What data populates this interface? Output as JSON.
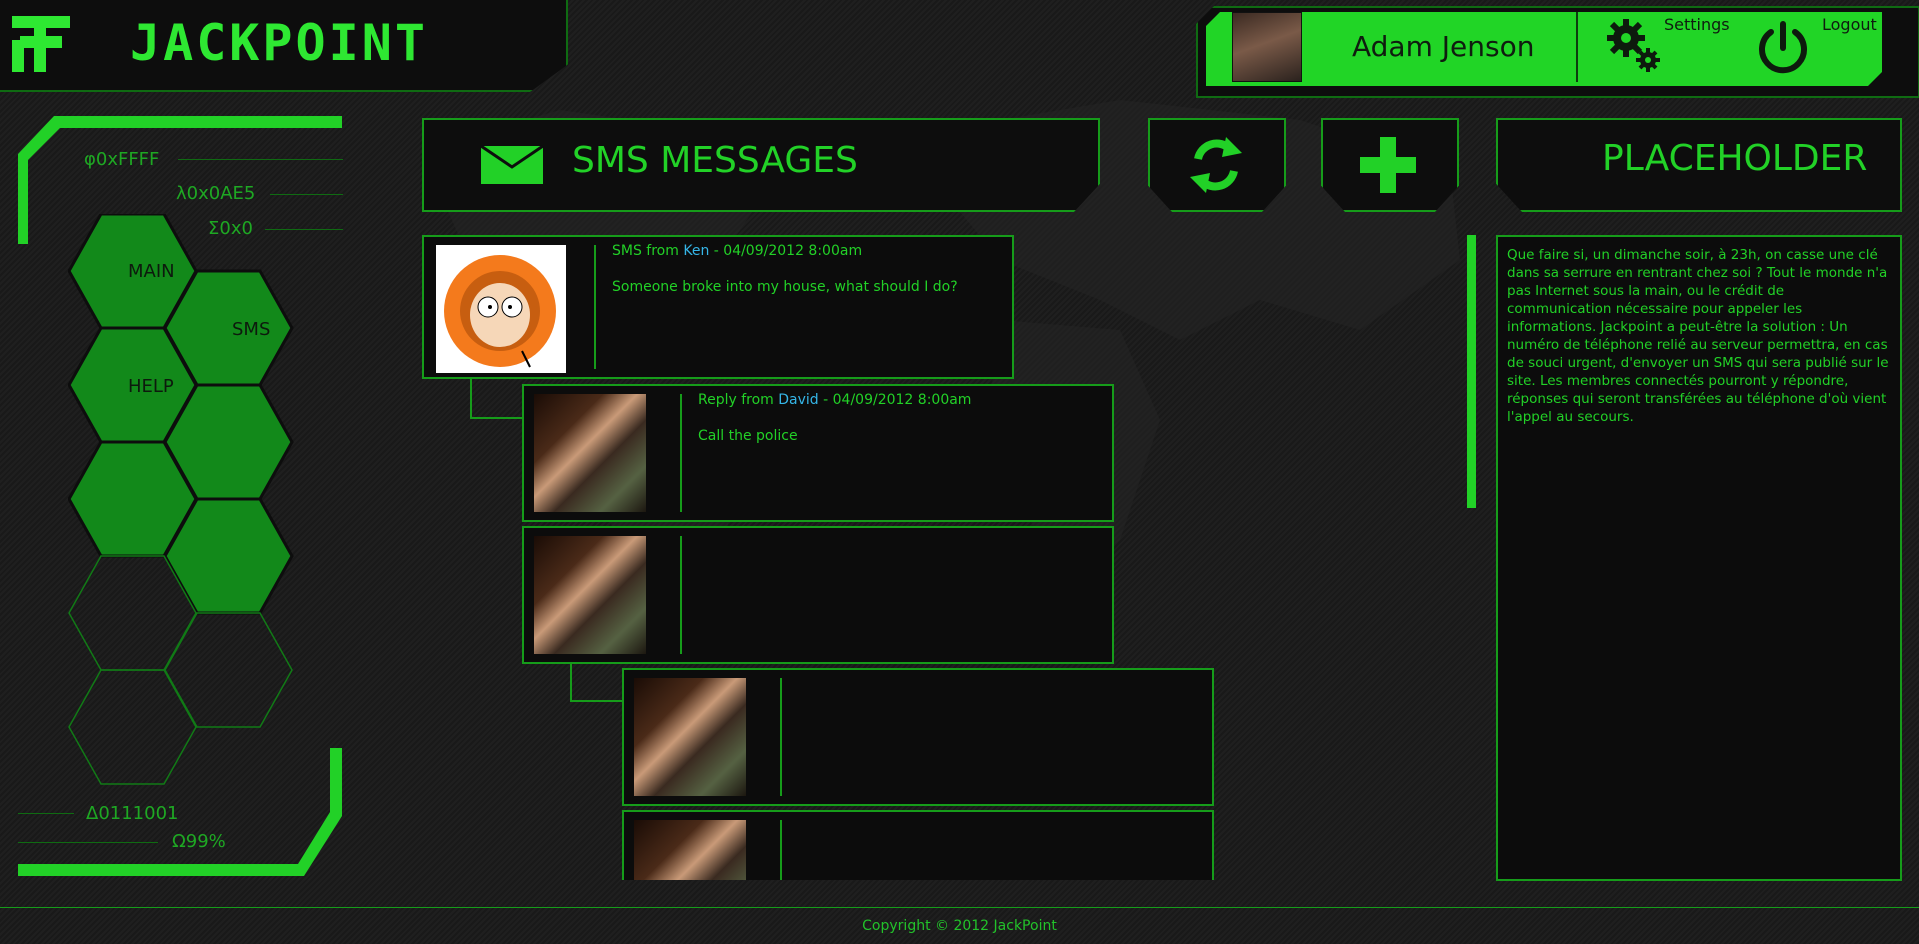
{
  "app": {
    "logo_text": "JACKPOINT"
  },
  "user": {
    "name": "Adam Jenson",
    "settings_label": "Settings",
    "logout_label": "Logout"
  },
  "codes": {
    "top": [
      "φ0xFFFF",
      "λ0x0AE5",
      "Σ0x0"
    ],
    "bottom": [
      "Δ0111001",
      "Ω99%"
    ]
  },
  "nav": {
    "main": "MAIN",
    "sms": "SMS",
    "help": "HELP"
  },
  "header": {
    "sms_title": "SMS MESSAGES",
    "placeholder_title": "PLACEHOLDER"
  },
  "messages": [
    {
      "prefix": "SMS from ",
      "author": "Ken",
      "suffix": " - 04/09/2012 8:00am",
      "body": "Someone broke into my house, what should I do?"
    },
    {
      "prefix": "Reply from ",
      "author": "David",
      "suffix": " - 04/09/2012 8:00am",
      "body": "Call the police"
    }
  ],
  "info_text": "Que faire si, un dimanche soir, à 23h, on casse une clé dans sa serrure en rentrant chez soi ? Tout le monde n'a pas Internet sous la main, ou le crédit de communication nécessaire pour appeler les informations. Jackpoint a peut-être la solution : Un numéro de téléphone relié au serveur permettra, en cas de souci urgent, d'envoyer un SMS qui sera publié sur le site. Les membres connectés pourront y répondre, réponses qui seront transférées au téléphone d'où vient l'appel au secours.",
  "footer": {
    "copyright": "Copyright © 2012 JackPoint"
  },
  "colors": {
    "accent": "#22d127",
    "dark": "#0d0d0d",
    "link": "#35b6e8"
  }
}
